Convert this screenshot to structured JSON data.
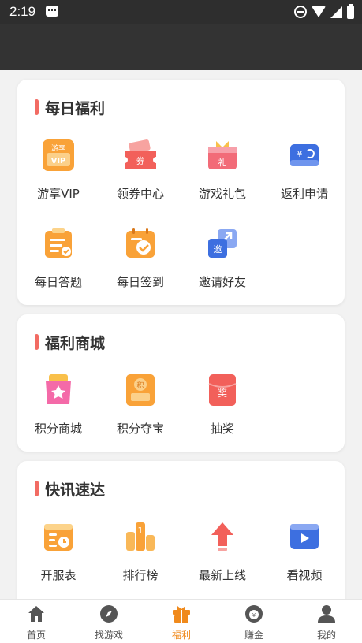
{
  "status": {
    "time": "2:19"
  },
  "sections": [
    {
      "title": "每日福利",
      "items": [
        {
          "label": "游享VIP",
          "icon": "vip-icon",
          "badge": "游享",
          "sub": "VIP"
        },
        {
          "label": "领券中心",
          "icon": "coupon-icon",
          "badge": "券"
        },
        {
          "label": "游戏礼包",
          "icon": "gift-pack-icon",
          "badge": "礼"
        },
        {
          "label": "返利申请",
          "icon": "rebate-icon",
          "badge": "¥"
        },
        {
          "label": "每日答题",
          "icon": "quiz-icon"
        },
        {
          "label": "每日签到",
          "icon": "checkin-icon"
        },
        {
          "label": "邀请好友",
          "icon": "invite-icon",
          "badge": "邀"
        }
      ]
    },
    {
      "title": "福利商城",
      "items": [
        {
          "label": "积分商城",
          "icon": "points-mall-icon"
        },
        {
          "label": "积分夺宝",
          "icon": "points-treasure-icon",
          "badge": "积"
        },
        {
          "label": "抽奖",
          "icon": "lottery-icon",
          "badge": "奖"
        }
      ]
    },
    {
      "title": "快讯速达",
      "items": [
        {
          "label": "开服表",
          "icon": "server-schedule-icon"
        },
        {
          "label": "排行榜",
          "icon": "ranking-icon",
          "badge": "1"
        },
        {
          "label": "最新上线",
          "icon": "new-release-icon"
        },
        {
          "label": "看视频",
          "icon": "video-icon"
        }
      ]
    }
  ],
  "tabs": [
    {
      "label": "首页",
      "icon": "home-icon"
    },
    {
      "label": "找游戏",
      "icon": "compass-icon"
    },
    {
      "label": "福利",
      "icon": "gift-icon",
      "active": true
    },
    {
      "label": "赚金",
      "icon": "money-bag-icon"
    },
    {
      "label": "我的",
      "icon": "user-icon"
    }
  ],
  "colors": {
    "accent": "#f08a1c",
    "title_bar": "#f26b63",
    "header": "#333333",
    "status_bar": "#2e2e2e"
  }
}
